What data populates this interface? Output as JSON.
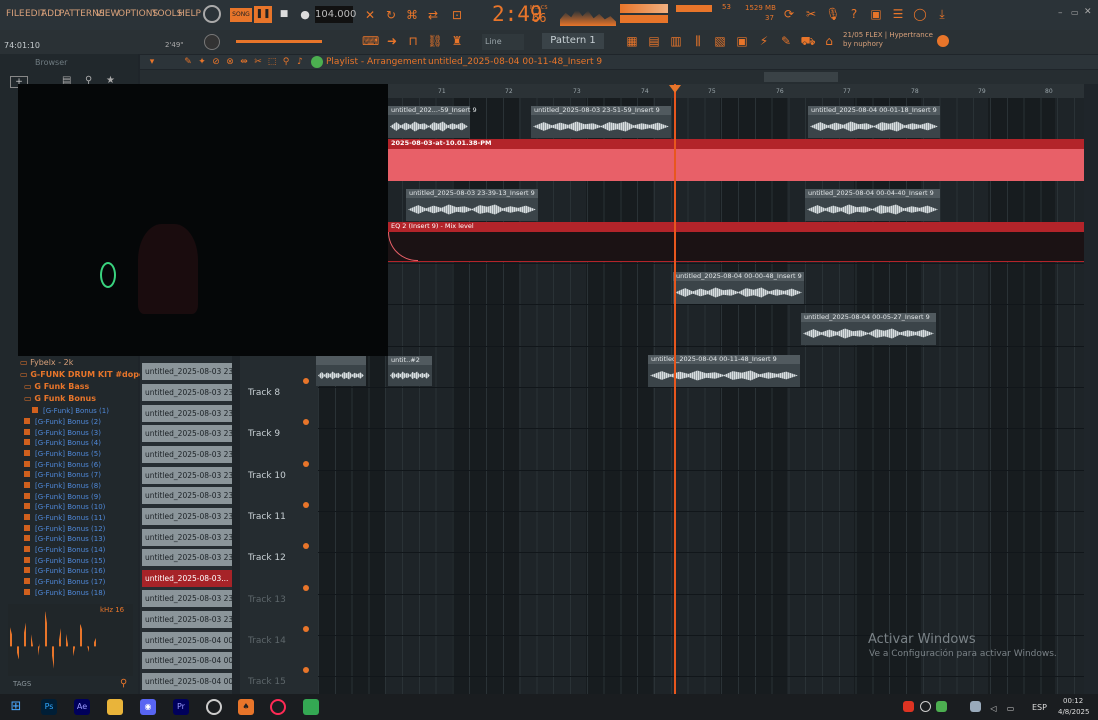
{
  "menu": {
    "items": [
      "FILE",
      "EDIT",
      "ADD",
      "PATTERNS",
      "VIEW",
      "OPTIONS",
      "TOOLS",
      "HELP"
    ]
  },
  "transport": {
    "song_label": "SONG",
    "tempo": "104.000",
    "time": "2:49",
    "time_sub": "66",
    "ms_label": "M:S:CS",
    "cpu": "53",
    "memory": "1529 MB",
    "polyphony": "37"
  },
  "toolbar2": {
    "timecode": "74:01:10",
    "position": "2'49\"",
    "snap": "Line",
    "pattern": "Pattern 1"
  },
  "flex": {
    "line1": "21/05 FLEX | Hypertrance",
    "line2": "by nuphory"
  },
  "browser": {
    "title": "Browser",
    "folders": [
      {
        "label": "Fybelx - 2k",
        "color": "#d7a07a"
      },
      {
        "label": "G-FUNK DRUM KIT #dopekit",
        "color": "#e8752a"
      },
      {
        "label": "G Funk Bass",
        "color": "#e8752a"
      },
      {
        "label": "G Funk Bonus",
        "color": "#e8752a"
      }
    ],
    "files": [
      "[G-Funk] Bonus (1)",
      "[G-Funk] Bonus (2)",
      "[G-Funk] Bonus (3)",
      "[G-Funk] Bonus (4)",
      "[G-Funk] Bonus (5)",
      "[G-Funk] Bonus (6)",
      "[G-Funk] Bonus (7)",
      "[G-Funk] Bonus (8)",
      "[G-Funk] Bonus (9)",
      "[G-Funk] Bonus (10)",
      "[G-Funk] Bonus (11)",
      "[G-Funk] Bonus (12)",
      "[G-Funk] Bonus (13)",
      "[G-Funk] Bonus (14)",
      "[G-Funk] Bonus (15)",
      "[G-Funk] Bonus (16)",
      "[G-Funk] Bonus (17)",
      "[G-Funk] Bonus (18)",
      "[G-Funk] Bonus (19)"
    ],
    "tags": "TAGS",
    "scope_label": "kHz 16"
  },
  "playlist": {
    "title": "Playlist - Arrangement",
    "breadcrumb": "untitled_2025-08-04 00-11-48_Insert 9",
    "ruler": [
      "71",
      "72",
      "73",
      "74",
      "75",
      "76",
      "77",
      "78",
      "79",
      "80"
    ],
    "clips": [
      {
        "name": "untitled_202...-59_Insert 9"
      },
      {
        "name": "untitled_2025-08-03 23-51-59_Insert 9"
      },
      {
        "name": "untitled_2025-08-04 00-01-18_Insert 9"
      },
      {
        "name": "2025-08-03-at-10.01.38-PM"
      },
      {
        "name": "untitled_2025-08-03 23-39-13_Insert 9"
      },
      {
        "name": "untitled_2025-08-04 00-04-40_Insert 9"
      },
      {
        "name": "EQ 2 (Insert 9) - Mix level"
      },
      {
        "name": "untitled_2025-08-04 00-00-48_Insert 9"
      },
      {
        "name": "untitled_2025-08-04 00-05-27_Insert 9"
      },
      {
        "name": "untit..#2"
      },
      {
        "name": "untitled_2025-08-04 00-11-48_Insert 9"
      }
    ],
    "clip_list": [
      "untitled_2025-08-03 23-...",
      "untitled_2025-08-03 23-...",
      "untitled_2025-08-03 23-...",
      "untitled_2025-08-03 23-...",
      "untitled_2025-08-03 23-...",
      "untitled_2025-08-03 23-...",
      "untitled_2025-08-03 23-...",
      "untitled_2025-08-03 23-...",
      "untitled_2025-08-03...",
      "untitled_2025-08-03 23-...",
      "untitled_2025-08-03 23-...",
      "untitled_2025-08-04 00-...",
      "untitled_2025-08-04 00-...",
      "untitled_2025-08-04 00-..."
    ],
    "tracks": [
      "Track 8",
      "Track 9",
      "Track 10",
      "Track 11",
      "Track 12",
      "Track 13",
      "Track 14",
      "Track 15"
    ]
  },
  "watermark": {
    "line1": "Activar Windows",
    "line2": "Ve a Configuración para activar Windows."
  },
  "taskbar": {
    "lang": "ESP",
    "time": "00:12",
    "date": "4/8/2025"
  }
}
